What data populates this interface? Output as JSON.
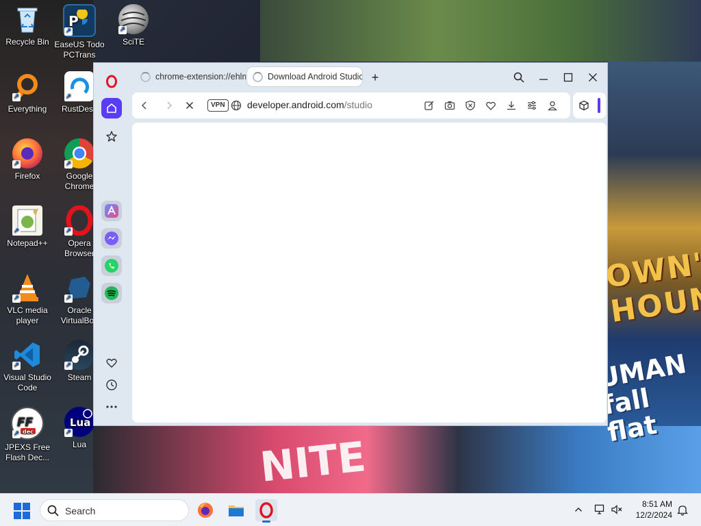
{
  "desktop": {
    "icons": [
      {
        "label": "Recycle Bin"
      },
      {
        "label": "EaseUS Todo PCTrans"
      },
      {
        "label": "SciTE"
      },
      {
        "label": "Everything"
      },
      {
        "label": "RustDesk"
      },
      {
        "label": "Firefox"
      },
      {
        "label": "Google Chrome"
      },
      {
        "label": "Notepad++"
      },
      {
        "label": "Opera Browser"
      },
      {
        "label": "VLC media player"
      },
      {
        "label": "Oracle VirtualBox"
      },
      {
        "label": "Visual Studio Code"
      },
      {
        "label": "Steam"
      },
      {
        "label": "JPEXS Free Flash Dec..."
      },
      {
        "label": "Lua"
      }
    ],
    "wallpaper_text": {
      "hounds": "OWN'S HOUNDS",
      "fallflat": "UMAN fall flat",
      "nite": "NITE"
    }
  },
  "browser": {
    "tabs": [
      {
        "title": "chrome-extension://ehlmj",
        "active": false
      },
      {
        "title": "Download Android Studio",
        "active": true
      }
    ],
    "new_tab_label": "+",
    "vpn_label": "VPN",
    "url_domain": "developer.android.com",
    "url_path": "/studio",
    "accent": "#5b3cf5",
    "opera_red": "#e3121b"
  },
  "taskbar": {
    "search_label": "Search",
    "time": "8:51 AM",
    "date": "12/2/2024"
  }
}
